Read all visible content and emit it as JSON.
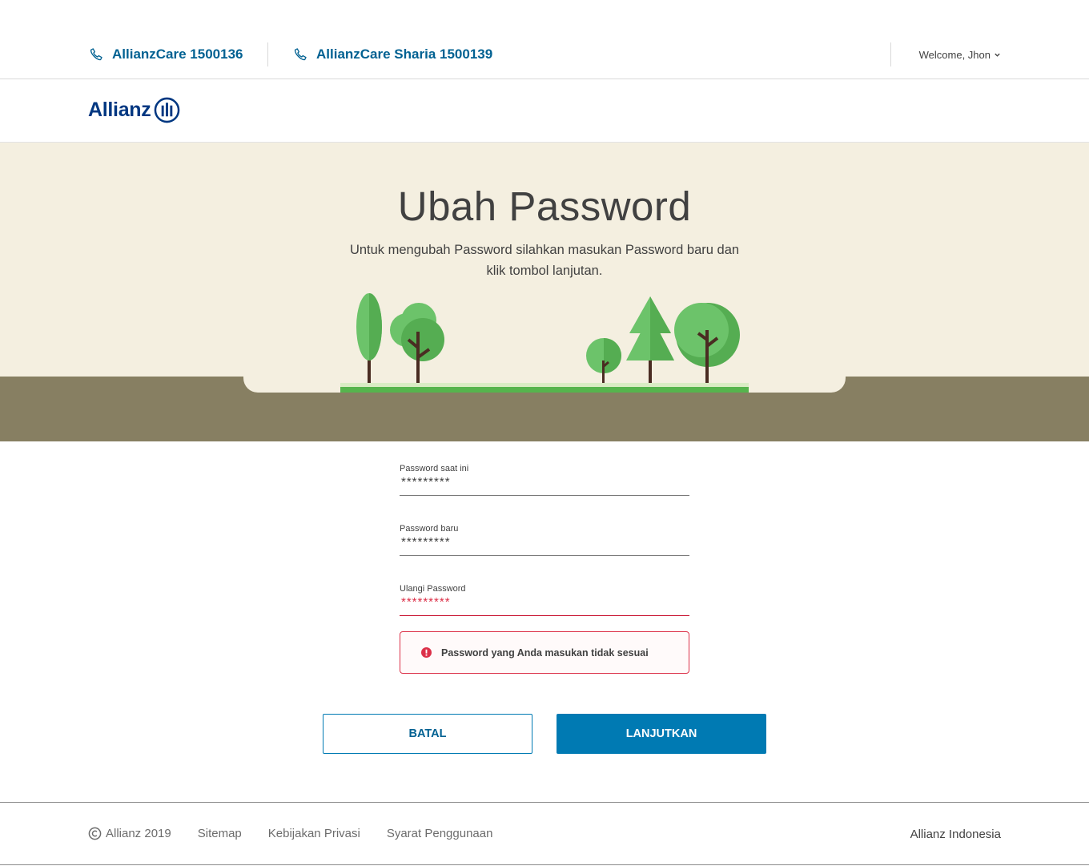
{
  "header": {
    "phone1": "AllianzCare 1500136",
    "phone2": "AllianzCare Sharia 1500139",
    "welcome": "Welcome, Jhon"
  },
  "logo": {
    "text": "Allianz"
  },
  "hero": {
    "title": "Ubah Password",
    "subtitle": "Untuk mengubah Password silahkan masukan Password baru dan klik tombol lanjutan."
  },
  "form": {
    "current": {
      "label": "Password saat ini",
      "value": "*********"
    },
    "new": {
      "label": "Password baru",
      "value": "*********"
    },
    "repeat": {
      "label": "Ulangi Password",
      "value": "*********"
    },
    "error": "Password yang Anda masukan tidak sesuai"
  },
  "buttons": {
    "cancel": "BATAL",
    "next": "LANJUTKAN"
  },
  "footer": {
    "copyright": "Allianz 2019",
    "links": [
      "Sitemap",
      "Kebijakan Privasi",
      "Syarat Penggunaan"
    ],
    "right": "Allianz Indonesia"
  },
  "colors": {
    "brand_blue": "#003781",
    "link_blue": "#006192",
    "button_blue": "#007ab3",
    "hero_bg": "#f4efe0",
    "ground": "#877f62",
    "error_red": "#dc3149"
  },
  "icons": [
    "phone-icon",
    "chevron-down-icon",
    "allianz-logo-icon",
    "error-icon",
    "copyright-icon"
  ]
}
